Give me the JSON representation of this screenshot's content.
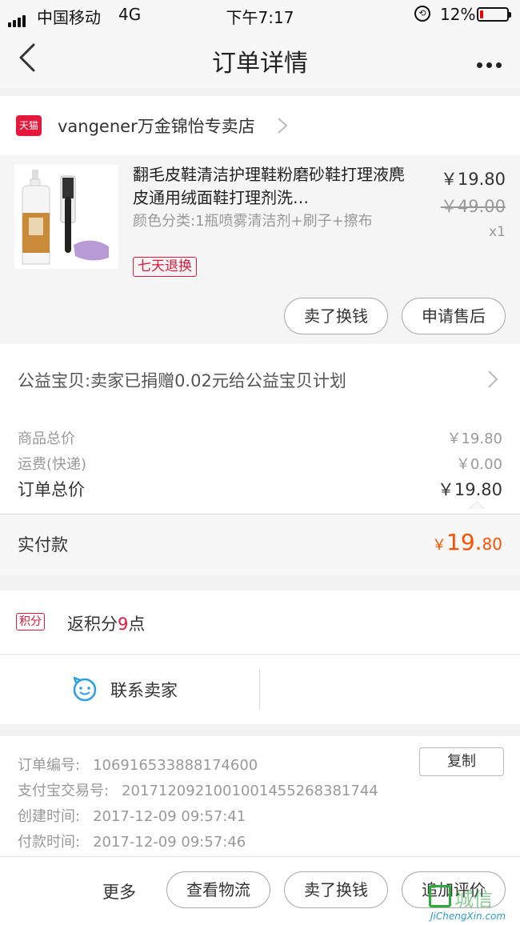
{
  "status_bar": {
    "carrier": "中国移动",
    "network": "4G",
    "time": "下午7:17",
    "battery_percent": "12%",
    "battery_level": 0.12
  },
  "nav": {
    "title": "订单详情"
  },
  "shop": {
    "platform_badge": "天猫",
    "name": "vangener万金锦怡专卖店"
  },
  "product": {
    "title": "翻毛皮鞋清洁护理鞋粉磨砂鞋打理液麂皮通用绒面鞋打理剂洗…",
    "spec": "颜色分类:1瓶喷雾清洁剂+刷子+擦布",
    "return_policy": "七天退换",
    "price": "￥19.80",
    "original_price": "￥49.00",
    "quantity": "x1",
    "sell_button": "卖了换钱",
    "aftersale_button": "申请售后"
  },
  "charity": {
    "text": "公益宝贝:卖家已捐赠0.02元给公益宝贝计划"
  },
  "summary": {
    "goods_total_label": "商品总价",
    "goods_total_value": "￥19.80",
    "shipping_label": "运费(快递)",
    "shipping_value": "￥0.00",
    "order_total_label": "订单总价",
    "order_total_value": "￥19.80"
  },
  "payment": {
    "label": "实付款",
    "currency": "￥",
    "integer": "19.",
    "decimal": "80"
  },
  "points": {
    "badge": "积分",
    "prefix": "返积分",
    "number": "9",
    "suffix": "点"
  },
  "contact": {
    "label": "联系卖家"
  },
  "order_info": {
    "order_no_label": "订单编号:",
    "order_no": "106916533888174600",
    "alipay_label": "支付宝交易号:",
    "alipay_no": "2017120921001001455268381744",
    "created_label": "创建时间:",
    "created_time": "2017-12-09 09:57:41",
    "paid_label": "付款时间:",
    "paid_time": "2017-12-09 09:57:46",
    "copy_button": "复制"
  },
  "bottom_bar": {
    "more": "更多",
    "logistics_button": "查看物流",
    "sell_button": "卖了换钱",
    "review_button": "追加评价"
  },
  "watermark": {
    "text": "城信",
    "url": "JiChengXin.com"
  },
  "colors": {
    "accent_red": "#e5173a",
    "price_orange": "#ff5000",
    "contact_blue": "#2d9ee8"
  }
}
